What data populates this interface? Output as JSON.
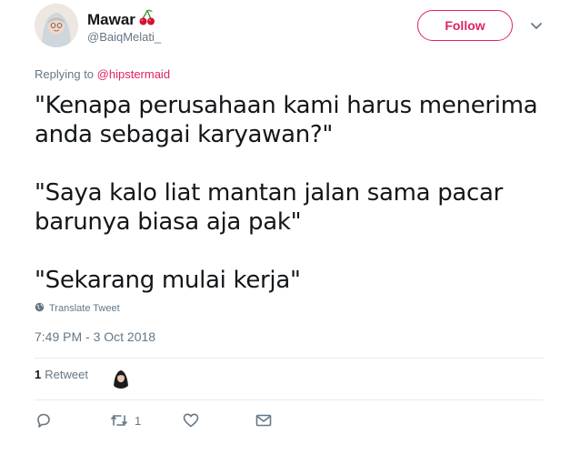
{
  "author": {
    "display_name": "Mawar",
    "emoji_icon": "cherries-icon",
    "username": "@BaiqMelati_"
  },
  "follow_label": "Follow",
  "reply_context": {
    "prefix": "Replying to ",
    "mention": "@hipstermaid"
  },
  "tweet_lines": [
    "\"Kenapa perusahaan kami harus menerima",
    "anda sebagai karyawan?\"",
    "\"Saya kalo liat mantan jalan sama pacar",
    "barunya biasa aja pak\"",
    "\"Sekarang mulai kerja\""
  ],
  "translate_label": "Translate Tweet",
  "timestamp": "7:49 PM - 3 Oct 2018",
  "stats": {
    "retweet_count": "1",
    "retweet_label": "Retweet"
  },
  "actions": {
    "retweet_count": "1"
  },
  "colors": {
    "accent": "#e0245e",
    "secondary_text": "#657786",
    "primary_text": "#14171a",
    "divider": "#e6ecf0"
  }
}
